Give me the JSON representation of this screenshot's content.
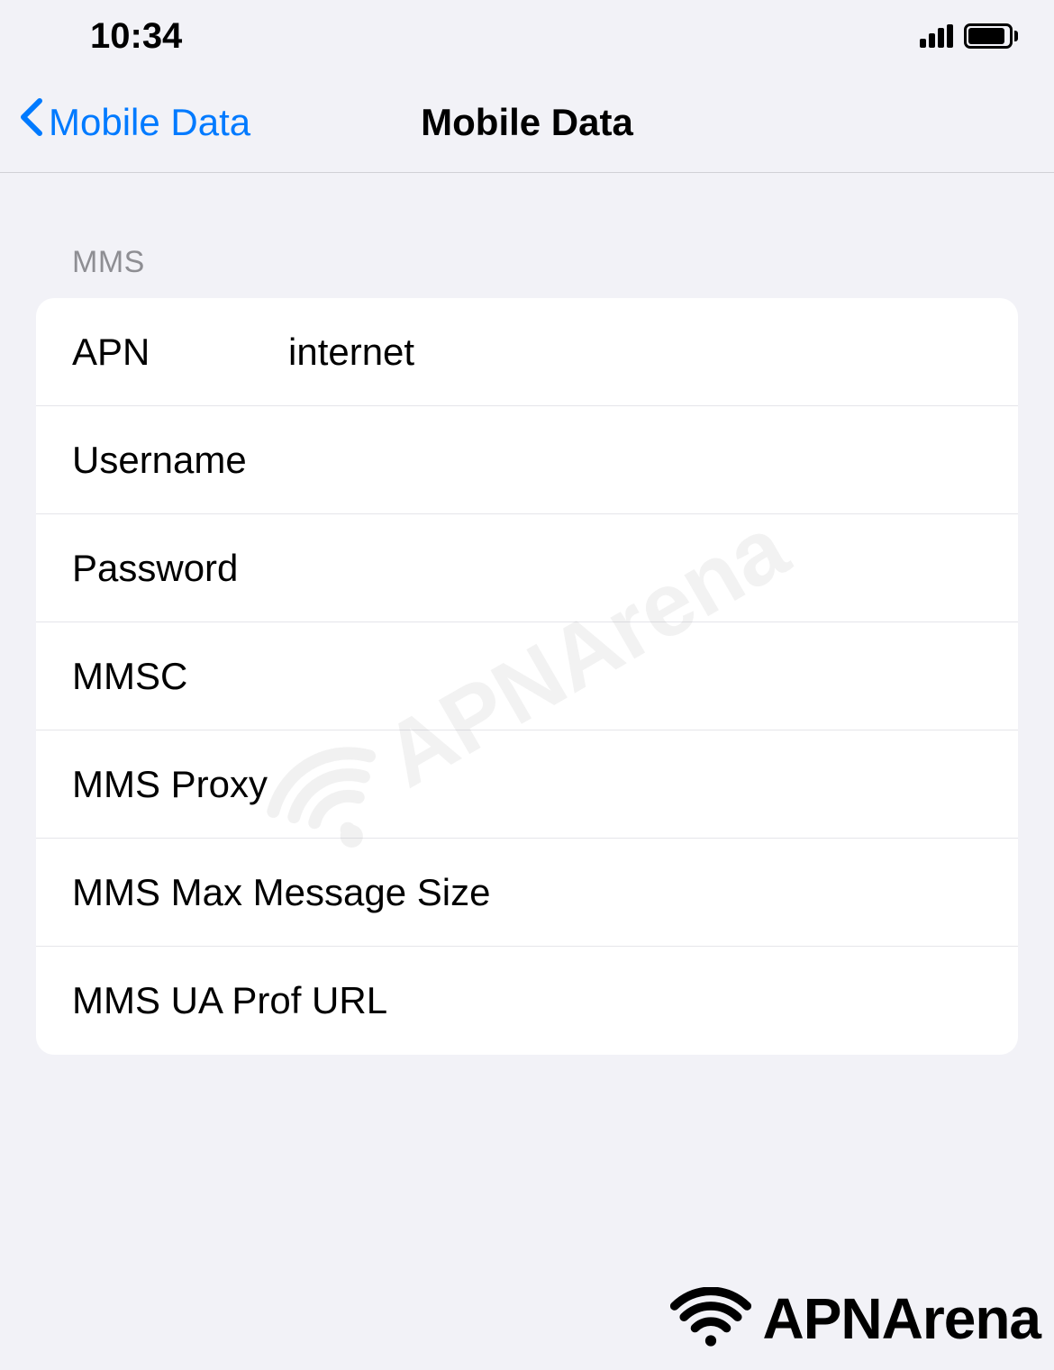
{
  "status_bar": {
    "time": "10:34"
  },
  "nav": {
    "back_label": "Mobile Data",
    "title": "Mobile Data"
  },
  "section": {
    "header": "MMS",
    "rows": [
      {
        "label": "APN",
        "value": "internet"
      },
      {
        "label": "Username",
        "value": ""
      },
      {
        "label": "Password",
        "value": ""
      },
      {
        "label": "MMSC",
        "value": ""
      },
      {
        "label": "MMS Proxy",
        "value": ""
      },
      {
        "label": "MMS Max Message Size",
        "value": ""
      },
      {
        "label": "MMS UA Prof URL",
        "value": ""
      }
    ]
  },
  "watermark": "APNArena",
  "footer_logo": "APNArena"
}
